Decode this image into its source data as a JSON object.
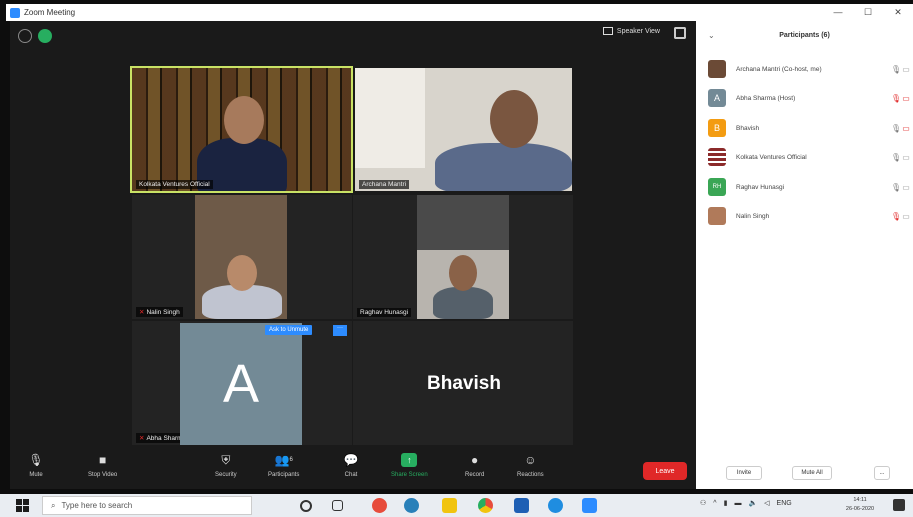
{
  "window": {
    "title": "Zoom Meeting",
    "controls": [
      "—",
      "☐",
      "✕"
    ]
  },
  "meeting": {
    "speaker_view_label": "Speaker View",
    "tiles": [
      {
        "name": "Kolkata Ventures Official",
        "muted": false,
        "active": true
      },
      {
        "name": "Archana Mantri",
        "muted": false
      },
      {
        "name": "Nalin Singh",
        "muted": true
      },
      {
        "name": "Raghav Hunasgi",
        "muted": false
      },
      {
        "name": "Abha Sharma",
        "muted": true,
        "avatar_letter": "A"
      },
      {
        "name": "Bhavish",
        "muted": false
      }
    ],
    "ask_to_unmute": "Ask to Unmute",
    "ask_more": "···"
  },
  "toolbar": {
    "mute": "Mute",
    "stop_video": "Stop Video",
    "security": "Security",
    "participants": "Participants",
    "participants_count": "6",
    "chat": "Chat",
    "share_screen": "Share Screen",
    "record": "Record",
    "reactions": "Reactions",
    "leave": "Leave"
  },
  "panel": {
    "title": "Participants (6)",
    "participants": [
      {
        "name": "Archana Mantri (Co-host, me)",
        "mic_muted": false,
        "cam_off": false,
        "color": "#6b4a36"
      },
      {
        "name": "Abha Sharma (Host)",
        "mic_muted": true,
        "cam_off": true,
        "color": "#738a96",
        "letter": "A"
      },
      {
        "name": "Bhavish",
        "mic_muted": false,
        "cam_off": true,
        "color": "#f39c12",
        "letter": "B"
      },
      {
        "name": "Kolkata Ventures Official",
        "mic_muted": false,
        "cam_off": false,
        "color": "#8b2a2a"
      },
      {
        "name": "Raghav Hunasgi",
        "mic_muted": false,
        "cam_off": false,
        "color": "#3aa655",
        "letter": "RH"
      },
      {
        "name": "Nalin Singh",
        "mic_muted": true,
        "cam_off": false,
        "color": "#b07a5a"
      }
    ],
    "invite": "Invite",
    "mute_all": "Mute All",
    "more": "..."
  },
  "taskbar": {
    "search_placeholder": "Type here to search",
    "tray_lang": "ENG",
    "time": "14:11",
    "date": "26-06-2020"
  }
}
